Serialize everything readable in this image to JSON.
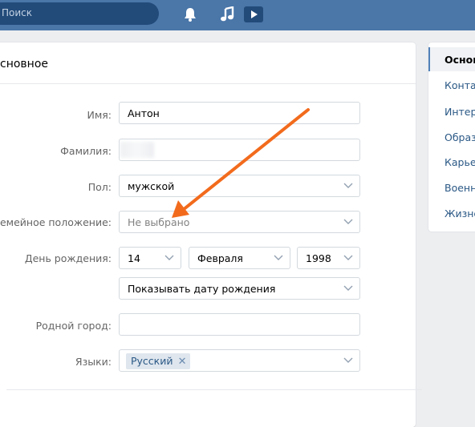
{
  "header": {
    "search_placeholder": "Поиск",
    "icons": [
      "bell-icon",
      "music-note-icon",
      "play-icon"
    ]
  },
  "form": {
    "section_title": "сновное",
    "rows": {
      "first_name": {
        "label": "Имя:",
        "value": "Антон"
      },
      "last_name": {
        "label": "Фамилия:",
        "value": ""
      },
      "gender": {
        "label": "Пол:",
        "value": "мужской"
      },
      "relationship": {
        "label": "Семейное положение:",
        "value": "Не выбрано"
      },
      "birthday": {
        "label": "День рождения:",
        "day": "14",
        "month": "Февраля",
        "year": "1998",
        "visibility": "Показывать дату рождения"
      },
      "hometown": {
        "label": "Родной город:",
        "value": ""
      },
      "languages": {
        "label": "Языки:",
        "token": "Русский"
      }
    }
  },
  "sidebar": {
    "items": [
      {
        "label": "Основ",
        "active": true
      },
      {
        "label": "Конта"
      },
      {
        "label": "Интер"
      },
      {
        "label": "Образ"
      },
      {
        "label": "Карьер"
      },
      {
        "label": "Военн"
      },
      {
        "label": "Жизне"
      }
    ]
  },
  "colors": {
    "header": "#4a76a8",
    "link": "#2a5885",
    "annotation_arrow": "#f26b1d"
  }
}
